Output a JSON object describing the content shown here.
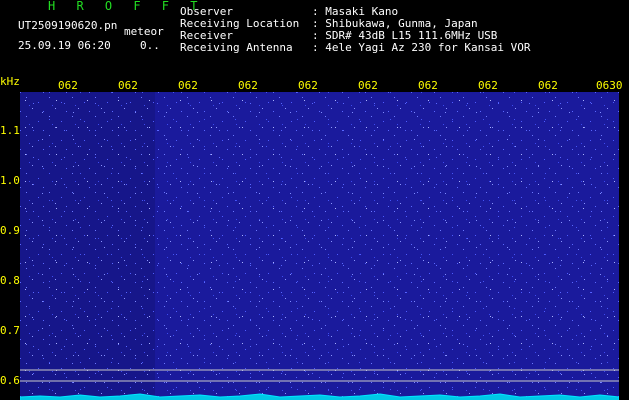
{
  "header": {
    "title": "H R O F F T",
    "filename": "UT2509190620.pn",
    "mode": "meteor",
    "datetime": "25.09.19 06:20",
    "counter": "0..",
    "info": [
      {
        "label": "Observer",
        "value": ": Masaki Kano"
      },
      {
        "label": "Receiving Location",
        "value": ": Shibukawa, Gunma, Japan"
      },
      {
        "label": "Receiver",
        "value": ": SDR# 43dB L15 111.6MHz USB"
      },
      {
        "label": "Receiving Antenna",
        "value": ": 4ele Yagi Az 230 for Kansai VOR"
      }
    ]
  },
  "axis": {
    "unit": "kHz",
    "time_ticks": [
      "062",
      "062",
      "062",
      "062",
      "062",
      "062",
      "062",
      "062",
      "062",
      "0630"
    ],
    "freq_ticks": [
      "1.1",
      "1.0",
      "0.9",
      "0.8",
      "0.7",
      "0.6"
    ]
  },
  "colors": {
    "background": "#000000",
    "spectrogram": "#1a1a9c",
    "dots": "#5a6aff",
    "signal_trace": "#00e5ff",
    "axis_text": "#ffff00",
    "title_text": "#22dd22",
    "info_text": "#ffffff"
  }
}
